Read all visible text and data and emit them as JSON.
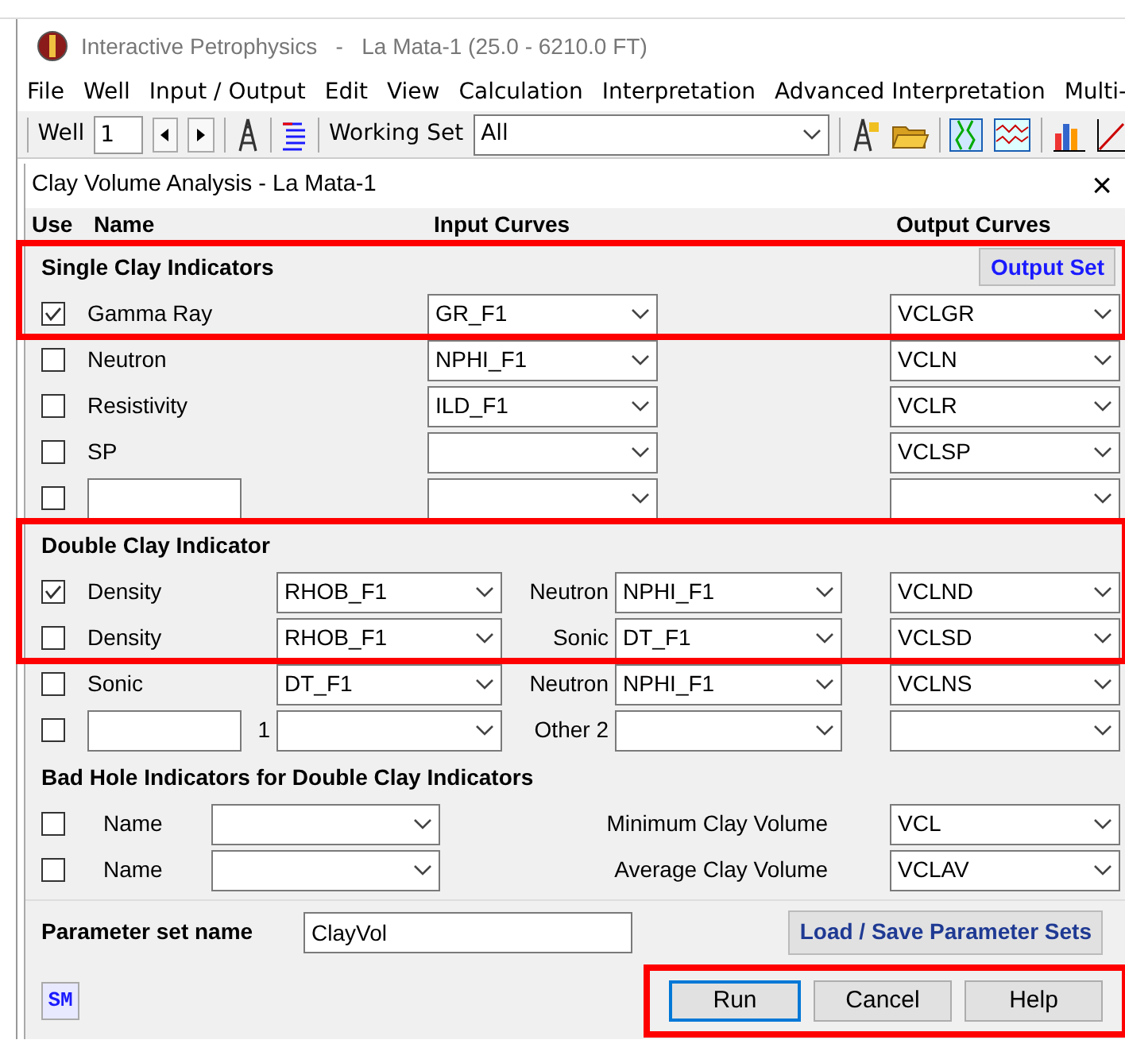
{
  "app": {
    "title": "Interactive Petrophysics   -   La Mata-1 (25.0 - 6210.0 FT)"
  },
  "menu": [
    "File",
    "Well",
    "Input / Output",
    "Edit",
    "View",
    "Calculation",
    "Interpretation",
    "Advanced Interpretation",
    "Multi-"
  ],
  "toolbar": {
    "well_label": "Well",
    "well_value": "1",
    "set_label": "Working Set",
    "set_value": "All"
  },
  "dialog": {
    "title": "Clay Volume Analysis - La Mata-1",
    "close": "×",
    "columns": [
      "Use",
      "Name",
      "Input Curves",
      "Output Curves"
    ],
    "sections": [
      {
        "kind": "single",
        "title": "Single Clay Indicators",
        "highlighted": true,
        "button": "Output Set",
        "rows": [
          {
            "kind": "named",
            "checked": true,
            "name": "Gamma Ray",
            "input": "GR_F1",
            "output": "VCLGR",
            "highlighted": true
          },
          {
            "kind": "named",
            "checked": false,
            "name": "Neutron",
            "input": "NPHI_F1",
            "output": "VCLN"
          },
          {
            "kind": "named",
            "checked": false,
            "name": "Resistivity",
            "input": "ILD_F1",
            "output": "VCLR"
          },
          {
            "kind": "named",
            "checked": false,
            "name": "SP",
            "output": "VCLSP"
          },
          {
            "kind": "custom",
            "checked": false
          }
        ]
      },
      {
        "kind": "double",
        "title": "Double Clay Indicator",
        "highlighted": true,
        "rows": [
          {
            "kind": "named",
            "checked": true,
            "name": "Density",
            "input": "RHOB_F1",
            "label2": "Neutron",
            "input2": "NPHI_F1",
            "output": "VCLND",
            "highlighted": true
          },
          {
            "kind": "named",
            "checked": false,
            "name": "Density",
            "input": "RHOB_F1",
            "label2": "Sonic",
            "input2": "DT_F1",
            "output": "VCLSD",
            "highlighted": true
          },
          {
            "kind": "named",
            "checked": false,
            "name": "Sonic",
            "input": "DT_F1",
            "label2": "Neutron",
            "input2": "NPHI_F1",
            "output": "VCLNS"
          },
          {
            "kind": "custom",
            "checked": false,
            "suffix": "1",
            "label2": "Other 2"
          }
        ]
      },
      {
        "kind": "badhole",
        "title": "Bad Hole Indicators for Double Clay Indicators",
        "rows": [
          {
            "kind": "named",
            "checked": false,
            "name": "Name",
            "label2": "Minimum Clay Volume",
            "output": "VCL"
          },
          {
            "kind": "named",
            "checked": false,
            "name": "Name",
            "label2": "Average Clay Volume",
            "output": "VCLAV"
          }
        ]
      }
    ],
    "parameter": {
      "label": "Parameter set name",
      "value": "ClayVol",
      "button": "Load / Save Parameter Sets"
    },
    "logo": "SM",
    "buttons": [
      {
        "label": "Run",
        "focused": true
      },
      {
        "label": "Cancel",
        "focused": false
      },
      {
        "label": "Help",
        "focused": false
      }
    ],
    "buttons_highlighted": true
  }
}
